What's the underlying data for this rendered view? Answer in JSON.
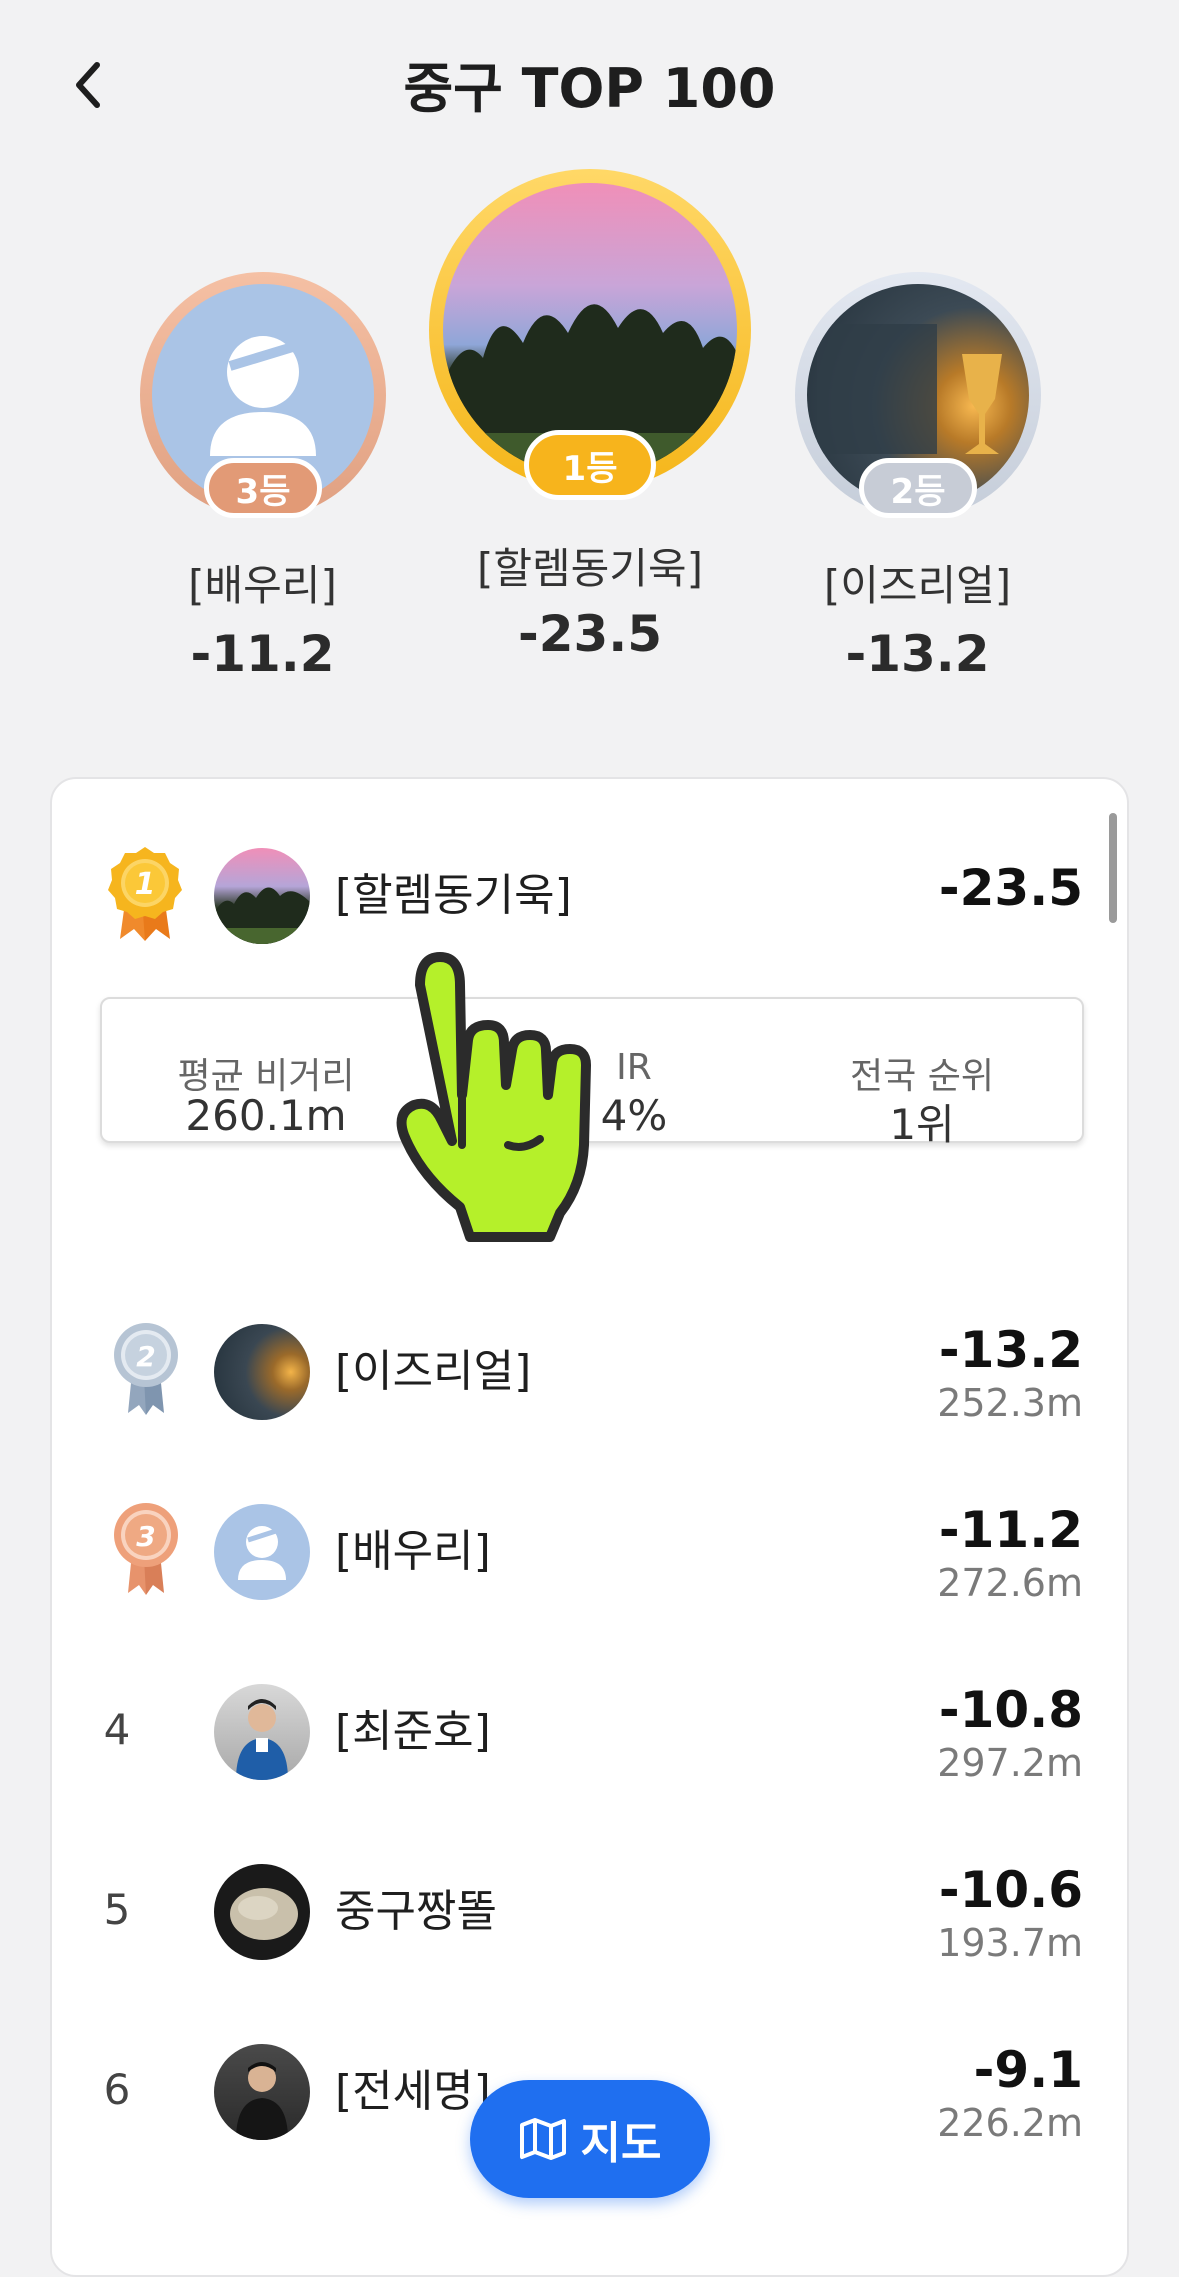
{
  "header": {
    "title": "중구 TOP 100"
  },
  "podium": [
    {
      "badge": "3등",
      "name": "[배우리]",
      "score": "-11.2"
    },
    {
      "badge": "1등",
      "name": "[할렘동기욱]",
      "score": "-23.5"
    },
    {
      "badge": "2등",
      "name": "[이즈리얼]",
      "score": "-13.2"
    }
  ],
  "ranking": {
    "rows": [
      {
        "rank": "1",
        "name": "[할렘동기욱]",
        "score": "-23.5",
        "distance": ""
      },
      {
        "rank": "2",
        "name": "[이즈리얼]",
        "score": "-13.2",
        "distance": "252.3m"
      },
      {
        "rank": "3",
        "name": "[배우리]",
        "score": "-11.2",
        "distance": "272.6m"
      },
      {
        "rank": "4",
        "name": "[최준호]",
        "score": "-10.8",
        "distance": "297.2m"
      },
      {
        "rank": "5",
        "name": "중구짱똘",
        "score": "-10.6",
        "distance": "193.7m"
      },
      {
        "rank": "6",
        "name": "[전세명]",
        "score": "-9.1",
        "distance": "226.2m"
      }
    ],
    "expanded_stats": {
      "avg_distance_label": "평균 비거리",
      "avg_distance_value": "260.1m",
      "gir_label": "IR",
      "gir_value": "4%",
      "national_rank_label": "전국 순위",
      "national_rank_value": "1위"
    }
  },
  "map_button": {
    "label": "지도"
  },
  "colors": {
    "gold": "#fbbf24",
    "silver": "#cbd5e1",
    "bronze": "#e9a27f",
    "accent": "#1f6ff0",
    "pointer": "#b5f02a"
  },
  "icons": [
    "back-chevron-icon",
    "gold-medal-icon",
    "silver-medal-icon",
    "bronze-medal-icon",
    "map-icon",
    "pointer-hand-icon"
  ]
}
